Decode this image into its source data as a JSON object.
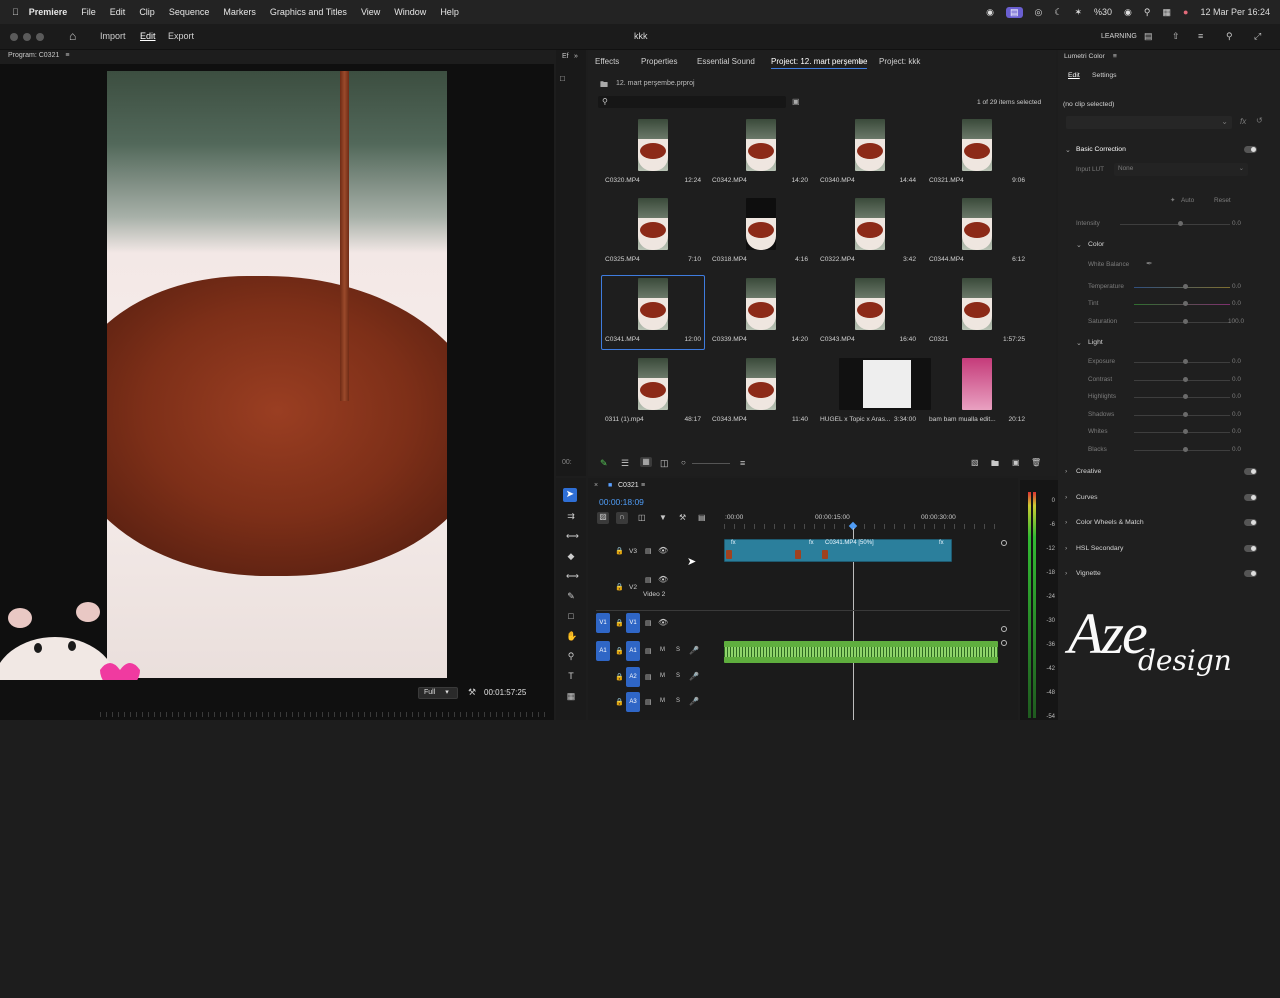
{
  "menubar": {
    "app": "Premiere",
    "items": [
      "File",
      "Edit",
      "Clip",
      "Sequence",
      "Markers",
      "Graphics and Titles",
      "View",
      "Window",
      "Help"
    ],
    "battery": "%30",
    "datetime": "12 Mar Per 16:24"
  },
  "appbar": {
    "nav": [
      "Import",
      "Edit",
      "Export"
    ],
    "title": "kkk",
    "learning": "LEARNING"
  },
  "program": {
    "title": "Program: C0321",
    "zoom": "Full",
    "timecode": "00:01:57:25"
  },
  "project": {
    "tabs": [
      "Effects",
      "Properties",
      "Essential Sound",
      "Project: 12. mart perşembe",
      "Project: kkk"
    ],
    "path": "12. mart perşembe.prproj",
    "count": "1 of 29 items selected",
    "left_tab": "Ef",
    "left_label": "00:"
  },
  "clips": [
    {
      "name": "C0320.MP4",
      "dur": "12:24"
    },
    {
      "name": "C0342.MP4",
      "dur": "14:20"
    },
    {
      "name": "C0340.MP4",
      "dur": "14:44"
    },
    {
      "name": "C0321.MP4",
      "dur": "9:06"
    },
    {
      "name": "C0325.MP4",
      "dur": "7:10"
    },
    {
      "name": "C0318.MP4",
      "dur": "4:16"
    },
    {
      "name": "C0322.MP4",
      "dur": "3:42"
    },
    {
      "name": "C0344.MP4",
      "dur": "6:12"
    },
    {
      "name": "C0341.MP4",
      "dur": "12:00"
    },
    {
      "name": "C0339.MP4",
      "dur": "14:20"
    },
    {
      "name": "C0343.MP4",
      "dur": "16:40"
    },
    {
      "name": "C0321",
      "dur": "1:57:25"
    },
    {
      "name": "0311 (1).mp4",
      "dur": "48:17"
    },
    {
      "name": "C0343.MP4",
      "dur": "11:40"
    },
    {
      "name": "HUGEL x Topic x Aras...",
      "dur": "3:34:00"
    },
    {
      "name": "bam bam mualla edit...",
      "dur": "20:12"
    }
  ],
  "timeline": {
    "seq": "C0321",
    "timecode": "00:00:18:09",
    "ruler": [
      ":00:00",
      "00:00:15:00",
      "00:00:30:00"
    ],
    "clip_label": "C0341.MP4 [50%]",
    "tracks": {
      "v3": "V3",
      "v2": "V2",
      "v2_name": "Video 2",
      "v1": "V1",
      "a1": "A1",
      "a2": "A2",
      "a3": "A3"
    },
    "meter": [
      "0",
      "-6",
      "-12",
      "-18",
      "-24",
      "-30",
      "-36",
      "-42",
      "-48",
      "-54"
    ],
    "mute": "M",
    "solo": "S"
  },
  "lumetri": {
    "title": "Lumetri Color",
    "tabs": [
      "Edit",
      "Settings"
    ],
    "noclip": "(no clip selected)",
    "fx": "fx",
    "basic": "Basic Correction",
    "input_lut": "Input LUT",
    "lut_val": "None",
    "auto": "Auto",
    "reset": "Reset",
    "intensity": "Intensity",
    "color": "Color",
    "white_balance": "White Balance",
    "temperature": "Temperature",
    "tint": "Tint",
    "saturation": "Saturation",
    "light": "Light",
    "exposure": "Exposure",
    "contrast": "Contrast",
    "highlights": "Highlights",
    "shadows": "Shadows",
    "whites": "Whites",
    "blacks": "Blacks",
    "val0": "0.0",
    "val100": "100.0",
    "sections": [
      "Creative",
      "Curves",
      "Color Wheels & Match",
      "HSL Secondary",
      "Vignette"
    ]
  },
  "watermark": {
    "big": "Aze",
    "small": "design"
  }
}
